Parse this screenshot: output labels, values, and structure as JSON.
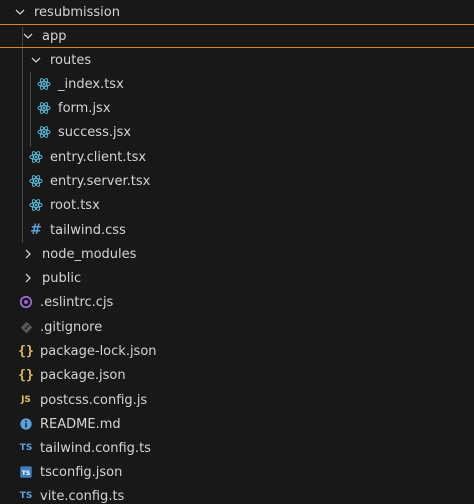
{
  "tree": {
    "root": {
      "label": "resubmission",
      "icon": "chevron-down-icon"
    },
    "app": {
      "label": "app",
      "icon": "chevron-down-icon"
    },
    "routes": {
      "label": "routes",
      "icon": "chevron-down-icon"
    },
    "index_tsx": {
      "label": "_index.tsx",
      "icon": "react-icon"
    },
    "form_jsx": {
      "label": "form.jsx",
      "icon": "react-icon"
    },
    "success_jsx": {
      "label": "success.jsx",
      "icon": "react-icon"
    },
    "entry_client": {
      "label": "entry.client.tsx",
      "icon": "react-icon"
    },
    "entry_server": {
      "label": "entry.server.tsx",
      "icon": "react-icon"
    },
    "root_tsx": {
      "label": "root.tsx",
      "icon": "react-icon"
    },
    "tailwind_css": {
      "label": "tailwind.css",
      "icon": "hash-icon"
    },
    "node_modules": {
      "label": "node_modules",
      "icon": "chevron-right-icon"
    },
    "public": {
      "label": "public",
      "icon": "chevron-right-icon"
    },
    "eslintrc": {
      "label": ".eslintrc.cjs",
      "icon": "eslint-icon"
    },
    "gitignore": {
      "label": ".gitignore",
      "icon": "git-icon"
    },
    "package_lock": {
      "label": "package-lock.json",
      "icon": "json-braces-icon"
    },
    "package_json": {
      "label": "package.json",
      "icon": "json-braces-icon"
    },
    "postcss": {
      "label": "postcss.config.js",
      "icon": "js-icon"
    },
    "readme": {
      "label": "README.md",
      "icon": "info-icon"
    },
    "tailwind_config": {
      "label": "tailwind.config.ts",
      "icon": "ts-icon"
    },
    "tsconfig": {
      "label": "tsconfig.json",
      "icon": "tsconfig-icon"
    },
    "vite_config": {
      "label": "vite.config.ts",
      "icon": "ts-icon"
    }
  },
  "colors": {
    "background": "#181818",
    "focus_border": "#e3831d",
    "react": "#5cc7e8",
    "json": "#e2c04f",
    "js": "#e2c04f",
    "ts": "#5aa2dc",
    "eslint": "#9b6bd6",
    "info": "#5aa2dc",
    "git": "#8a8a8a",
    "css_hash": "#5aa2dc"
  }
}
